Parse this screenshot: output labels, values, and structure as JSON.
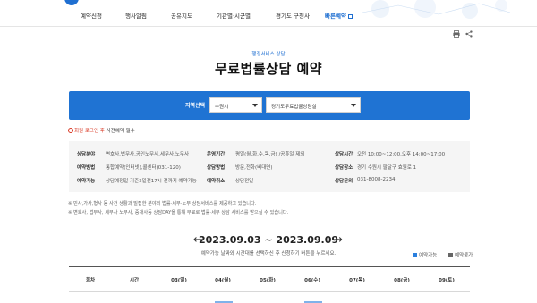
{
  "nav": {
    "items": [
      {
        "label": "예약신청",
        "active": false
      },
      {
        "label": "행사알림",
        "active": false
      },
      {
        "label": "공유지도",
        "active": false
      },
      {
        "label": "기관별·시군별",
        "active": false
      },
      {
        "label": "경기도 구청사",
        "active": false
      },
      {
        "label": "빠른예약",
        "active": true
      }
    ]
  },
  "tools": {
    "print_icon": "print-icon",
    "share_icon": "share-icon"
  },
  "page": {
    "category": "행정서비스 상담",
    "title": "무료법률상담 예약"
  },
  "region": {
    "label": "지역선택",
    "city": "수원시",
    "office": "경기도무료법률상담실"
  },
  "notice": {
    "text_red": "회원 로그인 후",
    "text_rest": " 사전예약 필수"
  },
  "info": {
    "rows": [
      [
        {
          "k": "상담분야",
          "v": "변호사,법무사,공인노무사,세무사,노무사"
        },
        {
          "k": "운영기간",
          "v": "평일(월,화,수,목,금) /공휴일 제외"
        },
        {
          "k": "상담시간",
          "v": "오전 10:00~12:00,오후 14:00~17:00"
        }
      ],
      [
        {
          "k": "예약방법",
          "v": "통합예약(인터넷),콜센터(031-120)"
        },
        {
          "k": "상담방법",
          "v": "방문,전화(비대면)"
        },
        {
          "k": "상담장소",
          "v": "경기 수원시 팔달구 효원로 1"
        }
      ],
      [
        {
          "k": "예약가능",
          "v": "상담예정일 기준3일전17시 전까지 예약가능"
        },
        {
          "k": "예약취소",
          "v": "상담전일"
        },
        {
          "k": "상담문의",
          "v": "031-8008-2234"
        }
      ]
    ]
  },
  "notes": [
    "※ 민사,가사,형사 등 사건 생활과 밀접한 분야의 법률·세무·노무 상담서비스를 제공하고 있습니다.",
    "※ 변호사, 법무사, 세무사 노무사, 중개사등 상담DAY을 통해 무료로 법률·세무 상담 서비스를 받으실 수 있습니다."
  ],
  "week": {
    "prev": "←",
    "next": "→",
    "range": "2023.09.03 ~ 2023.09.09",
    "sub": "예약가능 날짜와 시간대를 선택하신 후 신청하기 버튼을 누르세요."
  },
  "legend": {
    "available": "예약가능",
    "unavailable": "예약불가",
    "available_color": "#2a7fde",
    "unavailable_color": "#666666"
  },
  "table": {
    "headers": [
      "회차",
      "시간",
      "03(일)",
      "04(월)",
      "05(화)",
      "06(수)",
      "07(목)",
      "08(금)",
      "09(토)"
    ]
  }
}
